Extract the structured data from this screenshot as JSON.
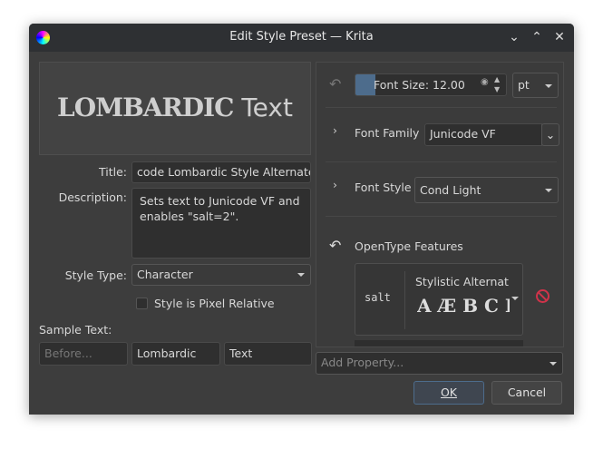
{
  "window": {
    "title": "Edit Style Preset — Krita",
    "controls": [
      "minimize",
      "maximize",
      "close"
    ]
  },
  "preview": {
    "lombardic": "LOMBARDIC",
    "plain": "Text"
  },
  "form": {
    "title_label": "Title:",
    "title_value": "code Lombardic Style Alternate",
    "description_label": "Description:",
    "description_value": "Sets text to Junicode VF and enables \"salt=2\".",
    "style_type_label": "Style Type:",
    "style_type_value": "Character",
    "pixel_relative_label": "Style is Pixel Relative",
    "pixel_relative_checked": false,
    "sample_text_label": "Sample Text:",
    "sample_before_placeholder": "Before...",
    "sample_main": "Lombardic",
    "sample_after": "Text"
  },
  "properties": {
    "font_size_label": "Font Size: 12.00",
    "font_size_progress": 0.08,
    "unit": "pt",
    "font_family_label": "Font Family",
    "font_family_value": "Junicode VF",
    "font_style_label": "Font Style",
    "font_style_value": "Cond Light",
    "opentype_label": "OpenType Features",
    "feature_tag": "salt",
    "feature_name": "Stylistic Alternate",
    "feature_glyphs": "A Æ B C I",
    "add_property_placeholder": "Add Property..."
  },
  "buttons": {
    "ok": "OK",
    "cancel": "Cancel"
  },
  "colors": {
    "accent": "#4d6c8c",
    "remove": "#d0334a"
  }
}
